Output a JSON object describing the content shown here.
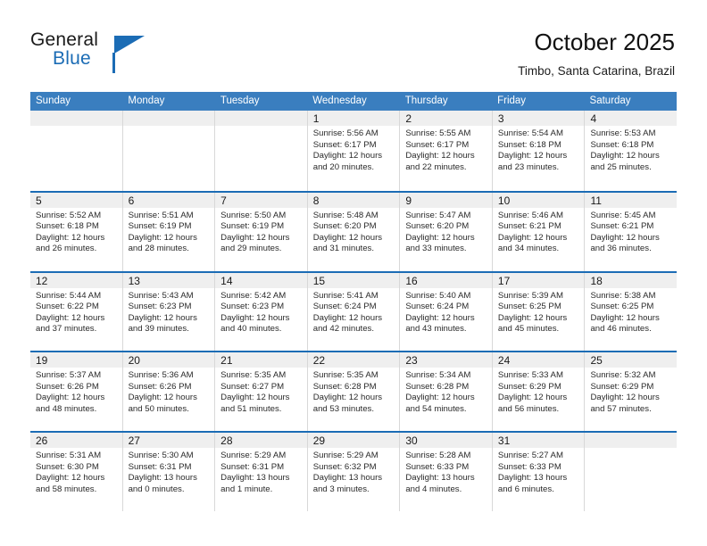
{
  "logo": {
    "word_one": "General",
    "word_two": "Blue",
    "accent_color": "#1b6cb5"
  },
  "header": {
    "title": "October 2025",
    "subtitle": "Timbo, Santa Catarina, Brazil"
  },
  "calendar": {
    "header_bg": "#3a7ebf",
    "row_divider_color": "#1b6cb5",
    "day_band_color": "#efefef",
    "weekdays": [
      "Sunday",
      "Monday",
      "Tuesday",
      "Wednesday",
      "Thursday",
      "Friday",
      "Saturday"
    ],
    "weeks": [
      [
        {
          "day": "",
          "lines": []
        },
        {
          "day": "",
          "lines": []
        },
        {
          "day": "",
          "lines": []
        },
        {
          "day": "1",
          "lines": [
            "Sunrise: 5:56 AM",
            "Sunset: 6:17 PM",
            "Daylight: 12 hours",
            "and 20 minutes."
          ]
        },
        {
          "day": "2",
          "lines": [
            "Sunrise: 5:55 AM",
            "Sunset: 6:17 PM",
            "Daylight: 12 hours",
            "and 22 minutes."
          ]
        },
        {
          "day": "3",
          "lines": [
            "Sunrise: 5:54 AM",
            "Sunset: 6:18 PM",
            "Daylight: 12 hours",
            "and 23 minutes."
          ]
        },
        {
          "day": "4",
          "lines": [
            "Sunrise: 5:53 AM",
            "Sunset: 6:18 PM",
            "Daylight: 12 hours",
            "and 25 minutes."
          ]
        }
      ],
      [
        {
          "day": "5",
          "lines": [
            "Sunrise: 5:52 AM",
            "Sunset: 6:18 PM",
            "Daylight: 12 hours",
            "and 26 minutes."
          ]
        },
        {
          "day": "6",
          "lines": [
            "Sunrise: 5:51 AM",
            "Sunset: 6:19 PM",
            "Daylight: 12 hours",
            "and 28 minutes."
          ]
        },
        {
          "day": "7",
          "lines": [
            "Sunrise: 5:50 AM",
            "Sunset: 6:19 PM",
            "Daylight: 12 hours",
            "and 29 minutes."
          ]
        },
        {
          "day": "8",
          "lines": [
            "Sunrise: 5:48 AM",
            "Sunset: 6:20 PM",
            "Daylight: 12 hours",
            "and 31 minutes."
          ]
        },
        {
          "day": "9",
          "lines": [
            "Sunrise: 5:47 AM",
            "Sunset: 6:20 PM",
            "Daylight: 12 hours",
            "and 33 minutes."
          ]
        },
        {
          "day": "10",
          "lines": [
            "Sunrise: 5:46 AM",
            "Sunset: 6:21 PM",
            "Daylight: 12 hours",
            "and 34 minutes."
          ]
        },
        {
          "day": "11",
          "lines": [
            "Sunrise: 5:45 AM",
            "Sunset: 6:21 PM",
            "Daylight: 12 hours",
            "and 36 minutes."
          ]
        }
      ],
      [
        {
          "day": "12",
          "lines": [
            "Sunrise: 5:44 AM",
            "Sunset: 6:22 PM",
            "Daylight: 12 hours",
            "and 37 minutes."
          ]
        },
        {
          "day": "13",
          "lines": [
            "Sunrise: 5:43 AM",
            "Sunset: 6:23 PM",
            "Daylight: 12 hours",
            "and 39 minutes."
          ]
        },
        {
          "day": "14",
          "lines": [
            "Sunrise: 5:42 AM",
            "Sunset: 6:23 PM",
            "Daylight: 12 hours",
            "and 40 minutes."
          ]
        },
        {
          "day": "15",
          "lines": [
            "Sunrise: 5:41 AM",
            "Sunset: 6:24 PM",
            "Daylight: 12 hours",
            "and 42 minutes."
          ]
        },
        {
          "day": "16",
          "lines": [
            "Sunrise: 5:40 AM",
            "Sunset: 6:24 PM",
            "Daylight: 12 hours",
            "and 43 minutes."
          ]
        },
        {
          "day": "17",
          "lines": [
            "Sunrise: 5:39 AM",
            "Sunset: 6:25 PM",
            "Daylight: 12 hours",
            "and 45 minutes."
          ]
        },
        {
          "day": "18",
          "lines": [
            "Sunrise: 5:38 AM",
            "Sunset: 6:25 PM",
            "Daylight: 12 hours",
            "and 46 minutes."
          ]
        }
      ],
      [
        {
          "day": "19",
          "lines": [
            "Sunrise: 5:37 AM",
            "Sunset: 6:26 PM",
            "Daylight: 12 hours",
            "and 48 minutes."
          ]
        },
        {
          "day": "20",
          "lines": [
            "Sunrise: 5:36 AM",
            "Sunset: 6:26 PM",
            "Daylight: 12 hours",
            "and 50 minutes."
          ]
        },
        {
          "day": "21",
          "lines": [
            "Sunrise: 5:35 AM",
            "Sunset: 6:27 PM",
            "Daylight: 12 hours",
            "and 51 minutes."
          ]
        },
        {
          "day": "22",
          "lines": [
            "Sunrise: 5:35 AM",
            "Sunset: 6:28 PM",
            "Daylight: 12 hours",
            "and 53 minutes."
          ]
        },
        {
          "day": "23",
          "lines": [
            "Sunrise: 5:34 AM",
            "Sunset: 6:28 PM",
            "Daylight: 12 hours",
            "and 54 minutes."
          ]
        },
        {
          "day": "24",
          "lines": [
            "Sunrise: 5:33 AM",
            "Sunset: 6:29 PM",
            "Daylight: 12 hours",
            "and 56 minutes."
          ]
        },
        {
          "day": "25",
          "lines": [
            "Sunrise: 5:32 AM",
            "Sunset: 6:29 PM",
            "Daylight: 12 hours",
            "and 57 minutes."
          ]
        }
      ],
      [
        {
          "day": "26",
          "lines": [
            "Sunrise: 5:31 AM",
            "Sunset: 6:30 PM",
            "Daylight: 12 hours",
            "and 58 minutes."
          ]
        },
        {
          "day": "27",
          "lines": [
            "Sunrise: 5:30 AM",
            "Sunset: 6:31 PM",
            "Daylight: 13 hours",
            "and 0 minutes."
          ]
        },
        {
          "day": "28",
          "lines": [
            "Sunrise: 5:29 AM",
            "Sunset: 6:31 PM",
            "Daylight: 13 hours",
            "and 1 minute."
          ]
        },
        {
          "day": "29",
          "lines": [
            "Sunrise: 5:29 AM",
            "Sunset: 6:32 PM",
            "Daylight: 13 hours",
            "and 3 minutes."
          ]
        },
        {
          "day": "30",
          "lines": [
            "Sunrise: 5:28 AM",
            "Sunset: 6:33 PM",
            "Daylight: 13 hours",
            "and 4 minutes."
          ]
        },
        {
          "day": "31",
          "lines": [
            "Sunrise: 5:27 AM",
            "Sunset: 6:33 PM",
            "Daylight: 13 hours",
            "and 6 minutes."
          ]
        },
        {
          "day": "",
          "lines": []
        }
      ]
    ]
  }
}
